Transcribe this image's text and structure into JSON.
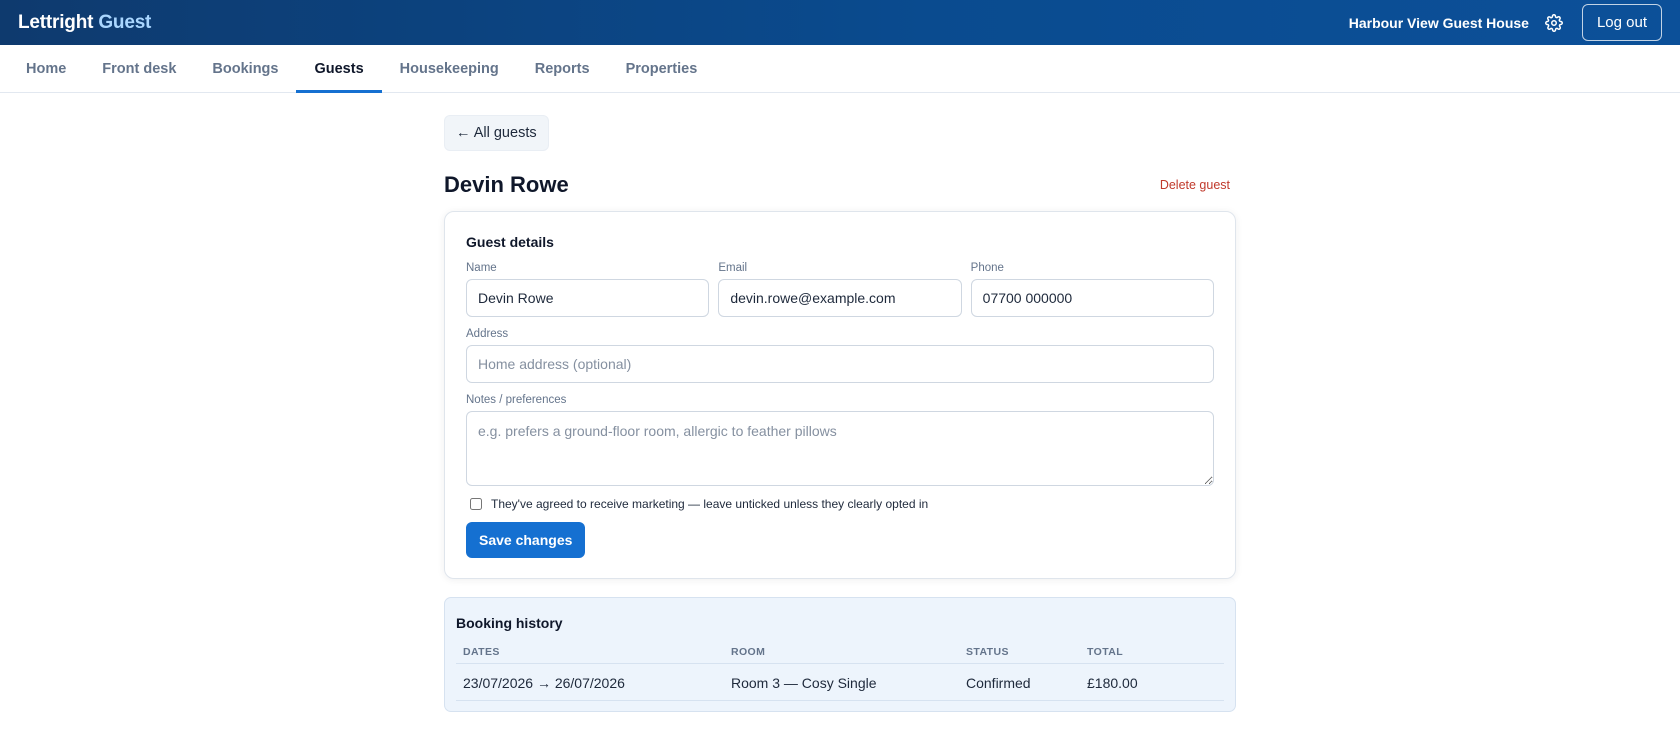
{
  "header": {
    "brand_main": "Lettright",
    "brand_accent": "Guest",
    "property_name": "Harbour View Guest House",
    "settings_icon": "gear-icon",
    "logout_label": "Log out"
  },
  "nav": {
    "tabs": [
      {
        "label": "Home",
        "active": false
      },
      {
        "label": "Front desk",
        "active": false
      },
      {
        "label": "Bookings",
        "active": false
      },
      {
        "label": "Guests",
        "active": true
      },
      {
        "label": "Housekeeping",
        "active": false
      },
      {
        "label": "Reports",
        "active": false
      },
      {
        "label": "Properties",
        "active": false
      }
    ]
  },
  "page": {
    "back_label": "← All guests",
    "title": "Devin Rowe",
    "delete_label": "Delete guest"
  },
  "form": {
    "section_title": "Guest details",
    "name_label": "Name",
    "name_value": "Devin Rowe",
    "email_label": "Email",
    "email_value": "devin.rowe@example.com",
    "phone_label": "Phone",
    "phone_value": "07700 000000",
    "address_label": "Address",
    "address_placeholder": "Home address (optional)",
    "notes_label": "Notes / preferences",
    "notes_placeholder": "e.g. prefers a ground-floor room, allergic to feather pillows",
    "marketing_label": "They've agreed to receive marketing — leave unticked unless they clearly opted in",
    "marketing_checked": false,
    "save_label": "Save changes"
  },
  "history": {
    "title": "Booking history",
    "columns": [
      "DATES",
      "ROOM",
      "STATUS",
      "TOTAL"
    ],
    "rows": [
      {
        "dates": "23/07/2026 → 26/07/2026",
        "room": "Room 3 — Cosy Single",
        "status": "Confirmed",
        "total": "£180.00"
      }
    ]
  },
  "colors": {
    "header_bg": "#0a4b8f",
    "brand_accent": "#a9d6ff",
    "primary": "#1570d1",
    "danger": "#c0392b",
    "history_bg": "#edf4fc"
  }
}
